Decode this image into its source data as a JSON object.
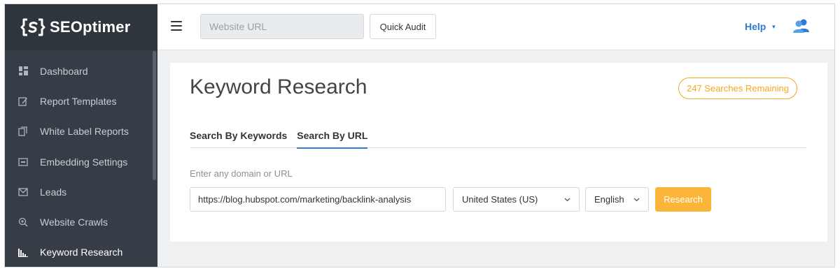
{
  "brand": {
    "name": "SEOptimer"
  },
  "sidebar": {
    "items": [
      {
        "label": "Dashboard",
        "icon": "dashboard-icon",
        "active": false
      },
      {
        "label": "Report Templates",
        "icon": "edit-icon",
        "active": false
      },
      {
        "label": "White Label Reports",
        "icon": "copy-icon",
        "active": false
      },
      {
        "label": "Embedding Settings",
        "icon": "embed-icon",
        "active": false
      },
      {
        "label": "Leads",
        "icon": "envelope-icon",
        "active": false
      },
      {
        "label": "Website Crawls",
        "icon": "zoom-icon",
        "active": false
      },
      {
        "label": "Keyword Research",
        "icon": "bar-chart-icon",
        "active": true
      }
    ]
  },
  "topbar": {
    "url_placeholder": "Website URL",
    "quick_audit_label": "Quick Audit",
    "help_label": "Help"
  },
  "main": {
    "title": "Keyword Research",
    "searches_remaining": "247 Searches Remaining",
    "tabs": [
      {
        "label": "Search By Keywords",
        "active": false
      },
      {
        "label": "Search By URL",
        "active": true
      }
    ],
    "field_label": "Enter any domain or URL",
    "domain_value": "https://blog.hubspot.com/marketing/backlink-analysis",
    "country_selected": "United States (US)",
    "language_selected": "English",
    "research_label": "Research"
  },
  "colors": {
    "sidebar_bg": "#363d46",
    "accent_blue": "#2a7dd1",
    "accent_orange": "#f5a623",
    "button_orange": "#fbb63a"
  }
}
